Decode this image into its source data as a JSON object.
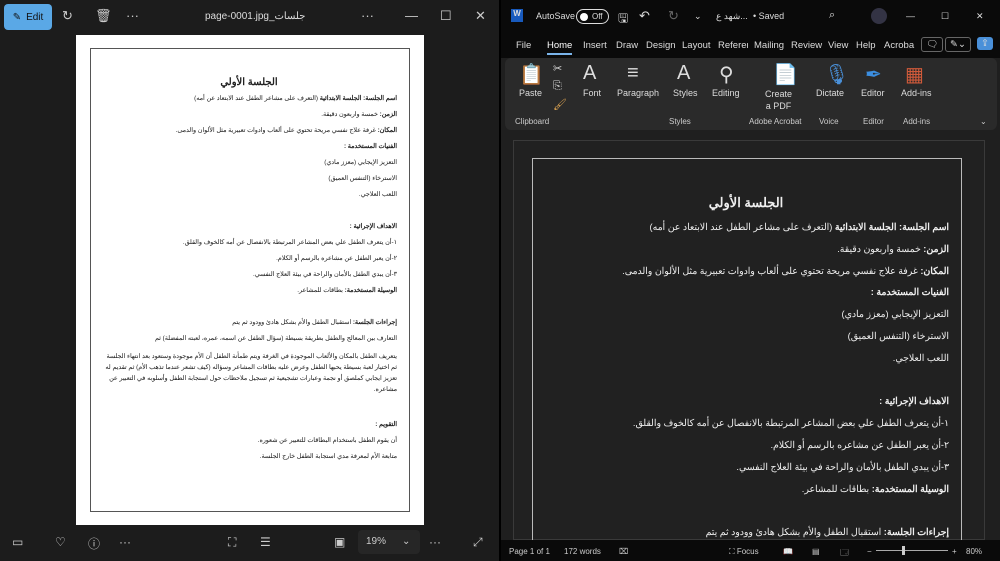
{
  "photos": {
    "edit_label": "Edit",
    "filename": "page-0001.jpg_جلسات",
    "zoom": "19%"
  },
  "word": {
    "autosave_label": "AutoSave",
    "autosave_state": "Off",
    "doc_title": "شهد ع...",
    "saved": "• Saved",
    "tabs": [
      "File",
      "Home",
      "Insert",
      "Draw",
      "Design",
      "Layout",
      "Referer",
      "Mailing",
      "Review",
      "View",
      "Help",
      "Acroba"
    ],
    "ribbon": {
      "paste": "Paste",
      "font": "Font",
      "paragraph": "Paragraph",
      "styles": "Styles",
      "editing": "Editing",
      "create_pdf_1": "Create",
      "create_pdf_2": "a PDF",
      "dictate": "Dictate",
      "editor": "Editor",
      "addins": "Add-ins",
      "groups": {
        "clipboard": "Clipboard",
        "styles": "Styles",
        "acrobat": "Adobe Acrobat",
        "voice": "Voice",
        "editor": "Editor",
        "addins": "Add-ins"
      }
    },
    "status": {
      "page": "Page 1 of 1",
      "words": "172 words",
      "focus": "Focus",
      "zoom": "80%"
    }
  },
  "document": {
    "title": "الجلسة الأولي",
    "lines": [
      {
        "type": "l",
        "label": "اسم الجلسة: الجلسة الابتدائية",
        "text": " (التعرف على مشاعر الطفل عند الابتعاد عن أمه)"
      },
      {
        "type": "l",
        "label": "الزمن:",
        "text": " خمسة واربعون دقيقة."
      },
      {
        "type": "l",
        "label": "المكان:",
        "text": " غرفة علاج نفسي مريحة تحتوي على ألعاب وادوات تعبيرية مثل الألوان والدمى."
      },
      {
        "type": "l",
        "label": "الفنيات المستخدمة :",
        "text": ""
      },
      {
        "type": "l",
        "label": "",
        "text": "التعزيز الإيجابي (معزز مادي)"
      },
      {
        "type": "l",
        "label": "",
        "text": "الاسترخاء (التنفس العميق)"
      },
      {
        "type": "l",
        "label": "",
        "text": "اللعب العلاجي."
      },
      {
        "type": "b"
      },
      {
        "type": "l",
        "label": "الاهداف الإجرائية :",
        "text": ""
      },
      {
        "type": "l",
        "label": "",
        "text": "١-أن يتعرف الطفل علي بعض المشاعر المرتبطة بالانفصال عن أمه كالخوف والقلق."
      },
      {
        "type": "l",
        "label": "",
        "text": "٢-أن يعبر الطفل عن مشاعره بالرسم أو الكلام."
      },
      {
        "type": "l",
        "label": "",
        "text": "٣-أن يبدي الطفل بالأمان والراحة في بيئة العلاج النفسي."
      },
      {
        "type": "l",
        "label": "الوسيلة المستخدمة:",
        "text": " بطاقات للمشاعر."
      },
      {
        "type": "b"
      },
      {
        "type": "l",
        "label": "إجراءات الجلسة:",
        "text": " استقبال الطفل والأم بشكل هادئ وودود ثم يتم"
      },
      {
        "type": "l",
        "label": "",
        "text": "التعارف بين المعالج والطفل بطريقة بسيطة (سؤال الطفل عن اسمه، عمره، لعبته المفضلة) ثم"
      },
      {
        "type": "p",
        "label": "",
        "text": "يتعريف الطفل بالمكان والألعاب الموجودة في الغرفة ويتم طمأنة الطفل أن الأم موجودة وستعود بعد انتهاء الجلسة ثم اختيار لعبة بسيطة يحبها الطفل وعرض عليه بطاقات المشاعر وسؤاله (كيف تشعر عندما تذهب الأم) ثم تقديم له تعزيز ايجابي كملصق أو نجمة وعبارات تشجيعية ثم تسجيل ملاحظات حول استجابة الطفل وأسلوبه في التعبير عن مشاعره."
      },
      {
        "type": "b"
      },
      {
        "type": "l",
        "label": "التقويم :",
        "text": ""
      },
      {
        "type": "l",
        "label": "",
        "text": "أن يقوم الطفل باستخدام البطاقات للتعبير عن شعوره."
      },
      {
        "type": "l",
        "label": "",
        "text": "متابعة الأم لمعرفة مدي استجابة الطفل خارج الجلسة."
      }
    ]
  }
}
